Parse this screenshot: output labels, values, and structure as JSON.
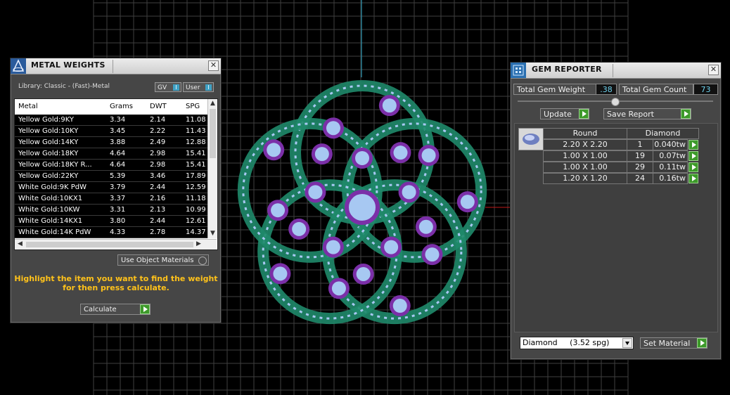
{
  "colors": {
    "accent_play": "#3d9a2a",
    "hint_text": "#ffc21a",
    "value_text": "#6fd3ef",
    "grid": "#3f3f3f",
    "gem_green": "#1f8a6a",
    "gem_purple": "#7b2fa8",
    "gem_blue": "#a7c8f2"
  },
  "metal_weights": {
    "title": "METAL WEIGHTS",
    "library_label": "Library: Classic - (Fast)-Metal",
    "gv_label": "GV",
    "user_label": "User",
    "columns": [
      "Metal",
      "Grams",
      "DWT",
      "SPG"
    ],
    "rows": [
      {
        "metal": "Yellow Gold:9KY",
        "grams": "3.34",
        "dwt": "2.14",
        "spg": "11.08"
      },
      {
        "metal": "Yellow Gold:10KY",
        "grams": "3.45",
        "dwt": "2.22",
        "spg": "11.43"
      },
      {
        "metal": "Yellow Gold:14KY",
        "grams": "3.88",
        "dwt": "2.49",
        "spg": "12.88"
      },
      {
        "metal": "Yellow Gold:18KY",
        "grams": "4.64",
        "dwt": "2.98",
        "spg": "15.41"
      },
      {
        "metal": "Yellow Gold:18KY R...",
        "grams": "4.64",
        "dwt": "2.98",
        "spg": "15.41"
      },
      {
        "metal": "Yellow Gold:22KY",
        "grams": "5.39",
        "dwt": "3.46",
        "spg": "17.89"
      },
      {
        "metal": "White Gold:9K PdW",
        "grams": "3.79",
        "dwt": "2.44",
        "spg": "12.59"
      },
      {
        "metal": "White Gold:10KX1",
        "grams": "3.37",
        "dwt": "2.16",
        "spg": "11.18"
      },
      {
        "metal": "White Gold:10KW",
        "grams": "3.31",
        "dwt": "2.13",
        "spg": "10.99"
      },
      {
        "metal": "White Gold:14KX1",
        "grams": "3.80",
        "dwt": "2.44",
        "spg": "12.61"
      },
      {
        "metal": "White Gold:14K PdW",
        "grams": "4.33",
        "dwt": "2.78",
        "spg": "14.37"
      }
    ],
    "use_object_materials": "Use Object Materials",
    "hint_line1": "Highlight the item you want to find the weight",
    "hint_line2": "for then press calculate.",
    "calculate_label": "Calculate"
  },
  "gem_reporter": {
    "title": "GEM REPORTER",
    "total_weight_label": "Total Gem Weight",
    "total_weight_value": ".38",
    "total_count_label": "Total Gem Count",
    "total_count_value": "73",
    "update_label": "Update",
    "save_report_label": "Save Report",
    "columns": [
      "Round",
      "Diamond"
    ],
    "rows": [
      {
        "size": "2.20 X 2.20",
        "count": "1",
        "weight": "0.040tw"
      },
      {
        "size": "1.00 X 1.00",
        "count": "19",
        "weight": "0.07tw"
      },
      {
        "size": "1.00 X 1.00",
        "count": "29",
        "weight": "0.11tw"
      },
      {
        "size": "1.20 X 1.20",
        "count": "24",
        "weight": "0.16tw"
      }
    ],
    "material_select": "Diamond     (3.52 spg)",
    "set_material_label": "Set Material"
  }
}
